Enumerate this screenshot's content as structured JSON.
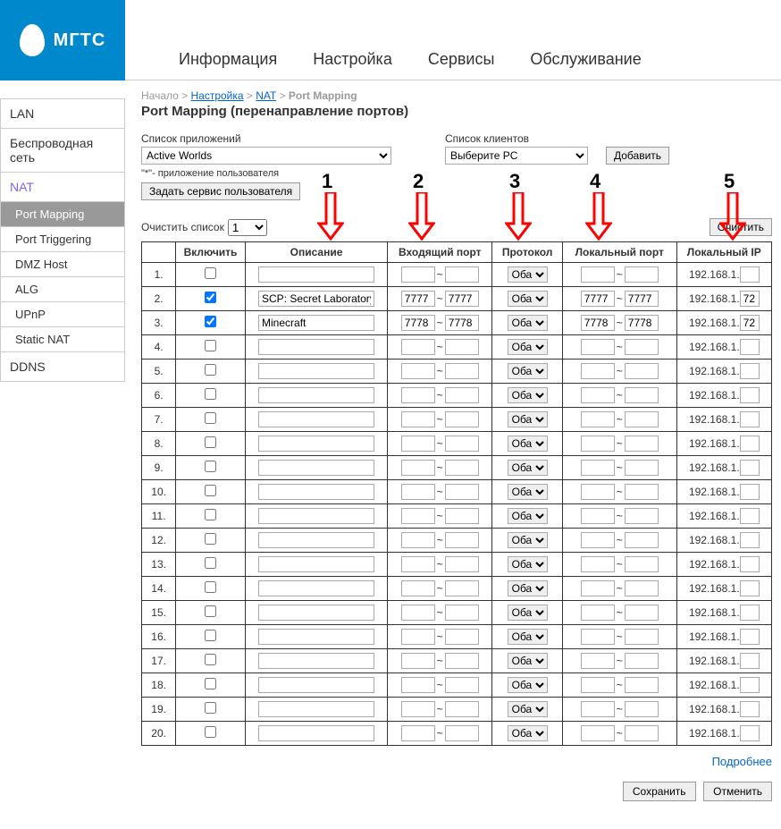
{
  "logo": {
    "text": "МГТС"
  },
  "nav": [
    "Информация",
    "Настройка",
    "Сервисы",
    "Обслуживание"
  ],
  "sidebar": {
    "groups": [
      {
        "label": "LAN",
        "active": false,
        "sub": []
      },
      {
        "label": "Беспроводная сеть",
        "active": false,
        "sub": []
      },
      {
        "label": "NAT",
        "active": true,
        "sub": [
          {
            "label": "Port Mapping",
            "active": true
          },
          {
            "label": "Port Triggering",
            "active": false
          },
          {
            "label": "DMZ Host",
            "active": false
          },
          {
            "label": "ALG",
            "active": false
          },
          {
            "label": "UPnP",
            "active": false
          },
          {
            "label": "Static NAT",
            "active": false
          }
        ]
      },
      {
        "label": "DDNS",
        "active": false,
        "sub": []
      }
    ]
  },
  "breadcrumb": {
    "home": "Начало",
    "parts": [
      "Настройка",
      "NAT"
    ],
    "current": "Port Mapping"
  },
  "page_title": "Port Mapping (перенаправление портов)",
  "controls": {
    "app_list_label": "Список приложений",
    "app_list_value": "Active Worlds",
    "client_list_label": "Список клиентов",
    "client_list_value": "Выберите PC",
    "add_btn": "Добавить",
    "user_app_note": "\"*\"- приложение пользователя",
    "user_service_btn": "Задать сервис пользователя"
  },
  "clear": {
    "label": "Очистить список",
    "value": "1",
    "btn": "Очистить"
  },
  "arrows": [
    "1",
    "2",
    "3",
    "4",
    "5"
  ],
  "table": {
    "headers": {
      "enable": "Включить",
      "desc": "Описание",
      "inport": "Входящий порт",
      "proto": "Протокол",
      "localport": "Локальный порт",
      "localip": "Локальный IP"
    },
    "ip_prefix": "192.168.1.",
    "proto_default": "Оба",
    "rows": [
      {
        "n": "1.",
        "en": false,
        "desc": "",
        "in1": "",
        "in2": "",
        "proto": "Оба",
        "lp1": "",
        "lp2": "",
        "ip": ""
      },
      {
        "n": "2.",
        "en": true,
        "desc": "SCP: Secret Laboratory",
        "in1": "7777",
        "in2": "7777",
        "proto": "Оба",
        "lp1": "7777",
        "lp2": "7777",
        "ip": "72"
      },
      {
        "n": "3.",
        "en": true,
        "desc": "Minecraft",
        "in1": "7778",
        "in2": "7778",
        "proto": "Оба",
        "lp1": "7778",
        "lp2": "7778",
        "ip": "72"
      },
      {
        "n": "4.",
        "en": false,
        "desc": "",
        "in1": "",
        "in2": "",
        "proto": "Оба",
        "lp1": "",
        "lp2": "",
        "ip": ""
      },
      {
        "n": "5.",
        "en": false,
        "desc": "",
        "in1": "",
        "in2": "",
        "proto": "Оба",
        "lp1": "",
        "lp2": "",
        "ip": ""
      },
      {
        "n": "6.",
        "en": false,
        "desc": "",
        "in1": "",
        "in2": "",
        "proto": "Оба",
        "lp1": "",
        "lp2": "",
        "ip": ""
      },
      {
        "n": "7.",
        "en": false,
        "desc": "",
        "in1": "",
        "in2": "",
        "proto": "Оба",
        "lp1": "",
        "lp2": "",
        "ip": ""
      },
      {
        "n": "8.",
        "en": false,
        "desc": "",
        "in1": "",
        "in2": "",
        "proto": "Оба",
        "lp1": "",
        "lp2": "",
        "ip": ""
      },
      {
        "n": "9.",
        "en": false,
        "desc": "",
        "in1": "",
        "in2": "",
        "proto": "Оба",
        "lp1": "",
        "lp2": "",
        "ip": ""
      },
      {
        "n": "10.",
        "en": false,
        "desc": "",
        "in1": "",
        "in2": "",
        "proto": "Оба",
        "lp1": "",
        "lp2": "",
        "ip": ""
      },
      {
        "n": "11.",
        "en": false,
        "desc": "",
        "in1": "",
        "in2": "",
        "proto": "Оба",
        "lp1": "",
        "lp2": "",
        "ip": ""
      },
      {
        "n": "12.",
        "en": false,
        "desc": "",
        "in1": "",
        "in2": "",
        "proto": "Оба",
        "lp1": "",
        "lp2": "",
        "ip": ""
      },
      {
        "n": "13.",
        "en": false,
        "desc": "",
        "in1": "",
        "in2": "",
        "proto": "Оба",
        "lp1": "",
        "lp2": "",
        "ip": ""
      },
      {
        "n": "14.",
        "en": false,
        "desc": "",
        "in1": "",
        "in2": "",
        "proto": "Оба",
        "lp1": "",
        "lp2": "",
        "ip": ""
      },
      {
        "n": "15.",
        "en": false,
        "desc": "",
        "in1": "",
        "in2": "",
        "proto": "Оба",
        "lp1": "",
        "lp2": "",
        "ip": ""
      },
      {
        "n": "16.",
        "en": false,
        "desc": "",
        "in1": "",
        "in2": "",
        "proto": "Оба",
        "lp1": "",
        "lp2": "",
        "ip": ""
      },
      {
        "n": "17.",
        "en": false,
        "desc": "",
        "in1": "",
        "in2": "",
        "proto": "Оба",
        "lp1": "",
        "lp2": "",
        "ip": ""
      },
      {
        "n": "18.",
        "en": false,
        "desc": "",
        "in1": "",
        "in2": "",
        "proto": "Оба",
        "lp1": "",
        "lp2": "",
        "ip": ""
      },
      {
        "n": "19.",
        "en": false,
        "desc": "",
        "in1": "",
        "in2": "",
        "proto": "Оба",
        "lp1": "",
        "lp2": "",
        "ip": ""
      },
      {
        "n": "20.",
        "en": false,
        "desc": "",
        "in1": "",
        "in2": "",
        "proto": "Оба",
        "lp1": "",
        "lp2": "",
        "ip": ""
      }
    ]
  },
  "footer": {
    "more": "Подробнее",
    "save": "Сохранить",
    "cancel": "Отменить"
  }
}
